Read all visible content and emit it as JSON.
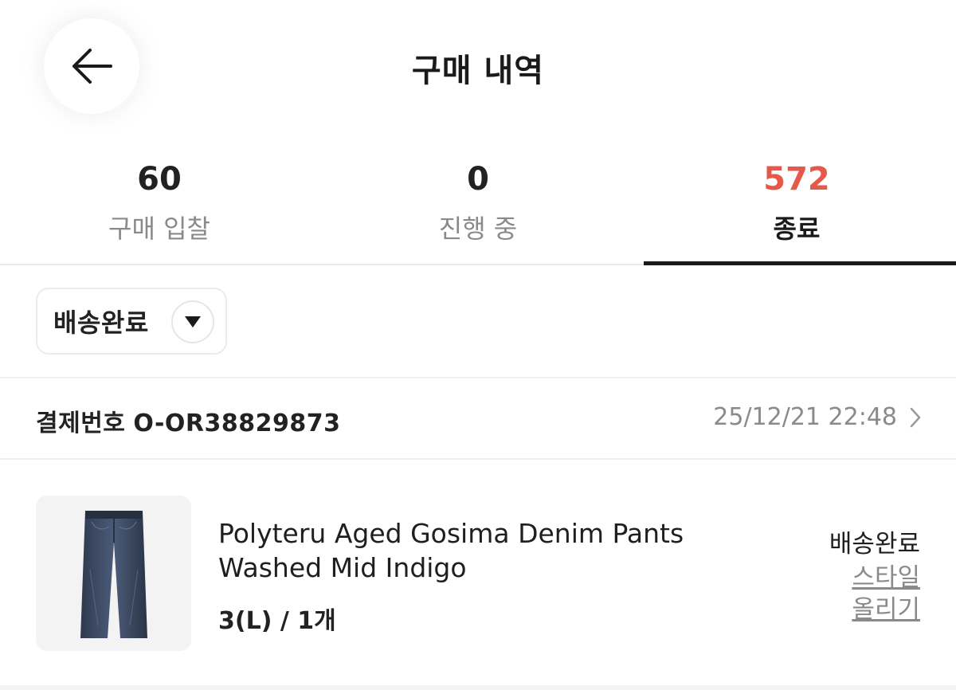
{
  "header": {
    "title": "구매 내역",
    "back_icon": "arrow-left-icon"
  },
  "tabs": [
    {
      "count": "60",
      "label": "구매 입찰",
      "active": false
    },
    {
      "count": "0",
      "label": "진행 중",
      "active": false
    },
    {
      "count": "572",
      "label": "종료",
      "active": true
    }
  ],
  "colors": {
    "accent": "#e6584a",
    "text": "#222222",
    "muted": "#8a8a8a"
  },
  "filter": {
    "selected": "배송완료",
    "icon": "caret-down-icon"
  },
  "order": {
    "number_label": "결제번호",
    "number": "O-OR38829873",
    "datetime": "25/12/21 22:48",
    "chevron_icon": "chevron-right-icon"
  },
  "product": {
    "name": "Polyteru Aged Gosima Denim Pants Washed Mid Indigo",
    "option": "3(L) / 1개",
    "status": "배송완료",
    "style_link": "스타일 올리기",
    "thumbnail_icon": "denim-pants-image"
  }
}
